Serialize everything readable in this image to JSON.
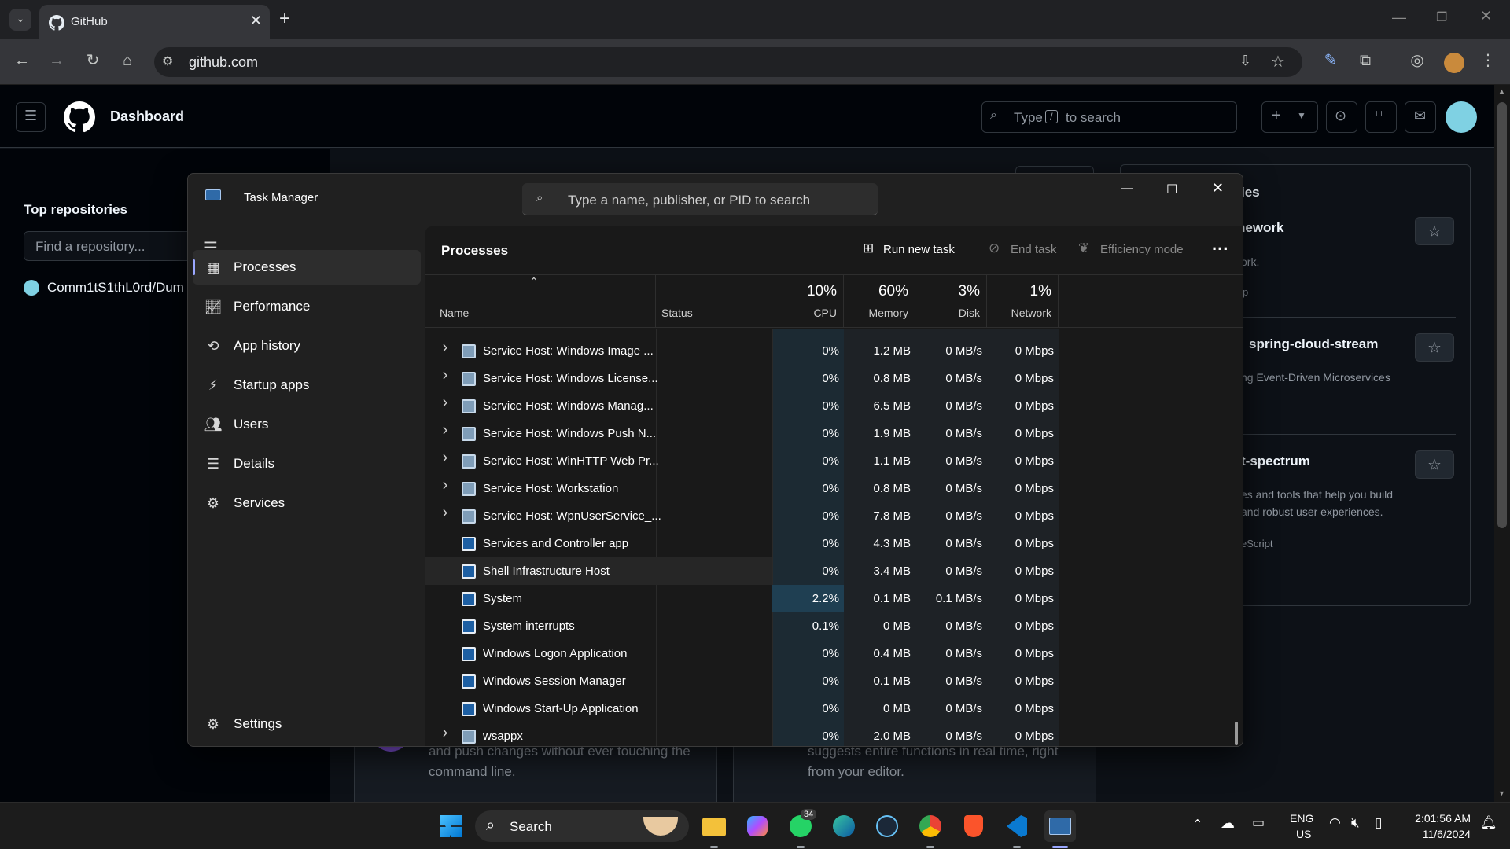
{
  "browser": {
    "tab_title": "GitHub",
    "url": "github.com",
    "colors": {
      "tabstrip": "#202124",
      "toolbar": "#35363a"
    }
  },
  "github": {
    "page_title": "Dashboard",
    "search_text_before": "Type",
    "search_key": "/",
    "search_text_after": "to search",
    "top_repos_heading": "Top repositories",
    "find_repo_placeholder": "Find a repository...",
    "repo_item": "Comm1tS1thL0rd/Dum",
    "right_panel": {
      "heading_fragment": "ies",
      "card1_title": "nework",
      "card1_desc": "ork.",
      "card1_meta": "p",
      "card2_title_prefix": "/",
      "card2_title": "spring-cloud-stream",
      "card2_desc": "ng Event-Driven Microservices",
      "card3_title": "t-spectrum",
      "card3_desc_line1": "es and tools that help you build",
      "card3_desc_line2": "and robust user experiences.",
      "card3_lang": "eScript"
    },
    "bottom_cards": {
      "left_line1": "and push changes without ever touching the",
      "left_line2": "command line.",
      "right_line1": "suggests entire functions in real time, right",
      "right_line2": "from your editor."
    }
  },
  "task_manager": {
    "title": "Task Manager",
    "search_placeholder": "Type a name, publisher, or PID to search",
    "nav": [
      {
        "label": "Processes",
        "icon": "processes-icon",
        "active": true
      },
      {
        "label": "Performance",
        "icon": "performance-icon",
        "active": false
      },
      {
        "label": "App history",
        "icon": "app-history-icon",
        "active": false
      },
      {
        "label": "Startup apps",
        "icon": "startup-apps-icon",
        "active": false
      },
      {
        "label": "Users",
        "icon": "users-icon",
        "active": false
      },
      {
        "label": "Details",
        "icon": "details-icon",
        "active": false
      },
      {
        "label": "Services",
        "icon": "services-icon",
        "active": false
      }
    ],
    "settings_label": "Settings",
    "page_heading": "Processes",
    "actions": {
      "run_new_task": "Run new task",
      "end_task": "End task",
      "efficiency_mode": "Efficiency mode",
      "more": "..."
    },
    "columns": {
      "name": "Name",
      "status": "Status",
      "cpu_pct": "10%",
      "cpu": "CPU",
      "memory_pct": "60%",
      "memory": "Memory",
      "disk_pct": "3%",
      "disk": "Disk",
      "network_pct": "1%",
      "network": "Network"
    },
    "rows": [
      {
        "name": "Service Host: Windows Image ...",
        "expandable": true,
        "icon": "service-gear-icon",
        "cpu": "0%",
        "memory": "1.2 MB",
        "disk": "0 MB/s",
        "network": "0 Mbps"
      },
      {
        "name": "Service Host: Windows License...",
        "expandable": true,
        "icon": "service-gear-icon",
        "cpu": "0%",
        "memory": "0.8 MB",
        "disk": "0 MB/s",
        "network": "0 Mbps"
      },
      {
        "name": "Service Host: Windows Manag...",
        "expandable": true,
        "icon": "service-gear-icon",
        "cpu": "0%",
        "memory": "6.5 MB",
        "disk": "0 MB/s",
        "network": "0 Mbps"
      },
      {
        "name": "Service Host: Windows Push N...",
        "expandable": true,
        "icon": "service-gear-icon",
        "cpu": "0%",
        "memory": "1.9 MB",
        "disk": "0 MB/s",
        "network": "0 Mbps"
      },
      {
        "name": "Service Host: WinHTTP Web Pr...",
        "expandable": true,
        "icon": "service-gear-icon",
        "cpu": "0%",
        "memory": "1.1 MB",
        "disk": "0 MB/s",
        "network": "0 Mbps"
      },
      {
        "name": "Service Host: Workstation",
        "expandable": true,
        "icon": "service-gear-icon",
        "cpu": "0%",
        "memory": "0.8 MB",
        "disk": "0 MB/s",
        "network": "0 Mbps"
      },
      {
        "name": "Service Host: WpnUserService_...",
        "expandable": true,
        "icon": "service-gear-icon",
        "cpu": "0%",
        "memory": "7.8 MB",
        "disk": "0 MB/s",
        "network": "0 Mbps"
      },
      {
        "name": "Services and Controller app",
        "expandable": false,
        "icon": "window-app-icon",
        "cpu": "0%",
        "memory": "4.3 MB",
        "disk": "0 MB/s",
        "network": "0 Mbps"
      },
      {
        "name": "Shell Infrastructure Host",
        "expandable": false,
        "icon": "window-app-icon",
        "cpu": "0%",
        "memory": "3.4 MB",
        "disk": "0 MB/s",
        "network": "0 Mbps",
        "hover": true
      },
      {
        "name": "System",
        "expandable": false,
        "icon": "window-app-icon",
        "cpu": "2.2%",
        "memory": "0.1 MB",
        "disk": "0.1 MB/s",
        "network": "0 Mbps",
        "cpu_highlight": true
      },
      {
        "name": "System interrupts",
        "expandable": false,
        "icon": "window-app-icon",
        "cpu": "0.1%",
        "memory": "0 MB",
        "disk": "0 MB/s",
        "network": "0 Mbps"
      },
      {
        "name": "Windows Logon Application",
        "expandable": false,
        "icon": "window-app-icon",
        "cpu": "0%",
        "memory": "0.4 MB",
        "disk": "0 MB/s",
        "network": "0 Mbps"
      },
      {
        "name": "Windows Session Manager",
        "expandable": false,
        "icon": "window-app-icon",
        "cpu": "0%",
        "memory": "0.1 MB",
        "disk": "0 MB/s",
        "network": "0 Mbps"
      },
      {
        "name": "Windows Start-Up Application",
        "expandable": false,
        "icon": "window-app-icon",
        "cpu": "0%",
        "memory": "0 MB",
        "disk": "0 MB/s",
        "network": "0 Mbps"
      },
      {
        "name": "wsappx",
        "expandable": true,
        "icon": "service-gear-icon",
        "cpu": "0%",
        "memory": "2.0 MB",
        "disk": "0 MB/s",
        "network": "0 Mbps"
      }
    ],
    "colors": {
      "accent": "#9aa7ff",
      "cpu_column_tint": "#1c2a33",
      "cpu_highlight": "#1f3f52"
    }
  },
  "taskbar": {
    "search_label": "Search",
    "whatsapp_badge": "34",
    "lang_line1": "ENG",
    "lang_line2": "US",
    "time": "2:01:56 AM",
    "date": "11/6/2024",
    "apps": [
      "start-icon",
      "file-explorer-icon",
      "copilot-icon",
      "whatsapp-icon",
      "edge-icon",
      "steam-icon",
      "chrome-icon",
      "brave-icon",
      "vscode-icon",
      "task-manager-icon"
    ]
  }
}
